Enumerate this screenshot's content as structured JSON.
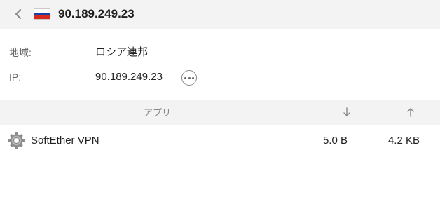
{
  "header": {
    "title": "90.189.249.23",
    "flag": {
      "country": "Russia",
      "colors": [
        "#ffffff",
        "#1c3fa6",
        "#d52b1e"
      ]
    }
  },
  "info": {
    "region_label": "地域:",
    "region_value": "ロシア連邦",
    "ip_label": "IP:",
    "ip_value": "90.189.249.23"
  },
  "table": {
    "columns": {
      "app": "アプリ",
      "download_icon": "arrow-down-icon",
      "upload_icon": "arrow-up-icon"
    },
    "rows": [
      {
        "icon": "gear-icon",
        "app": "SoftEther VPN",
        "download": "5.0 B",
        "upload": "4.2 KB"
      }
    ]
  },
  "colors": {
    "header_bg": "#f3f3f3",
    "text": "#222222",
    "muted": "#888888"
  }
}
